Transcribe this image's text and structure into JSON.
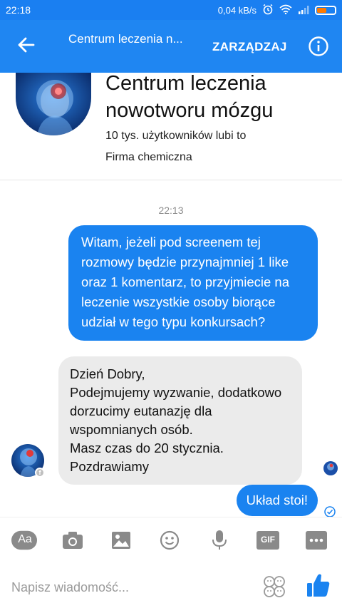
{
  "status_bar": {
    "time": "22:18",
    "speed": "0,04 kB/s",
    "battery_level": 0.55,
    "battery_color": "#ff7a00"
  },
  "header": {
    "title": "Centrum leczenia n...",
    "manage_label": "ZARZĄDZAJ",
    "back_icon": "arrow-left-icon",
    "info_icon": "info-icon",
    "color": "#1f86f2"
  },
  "profile": {
    "name": "Centrum leczenia nowotworu mózgu",
    "likes": "10 tys. użytkowników lubi to",
    "category": "Firma chemiczna"
  },
  "chat": {
    "timestamp": "22:13",
    "messages": [
      {
        "direction": "out",
        "text": "Witam, jeżeli pod screenem tej rozmowy będzie przynajmniej 1 like oraz 1 komentarz, to przyjmiecie na leczenie wszystkie osoby biorące udział w tego typu konkursach?"
      },
      {
        "direction": "in",
        "text": "Dzień Dobry,\nPodejmujemy wyzwanie, dodatkowo dorzucimy eutanazję dla wspomnianych osób.\nMasz czas do 20 stycznia.\nPozdrawiamy"
      },
      {
        "direction": "out",
        "text": "Układ stoi!"
      }
    ],
    "bubble_out_color": "#1a83f0",
    "bubble_in_color": "#ebebeb"
  },
  "toolbar": {
    "aa_label": "Aa",
    "gif_label": "GIF",
    "items": [
      "text-format-icon",
      "camera-icon",
      "gallery-icon",
      "emoji-icon",
      "microphone-icon",
      "gif-icon",
      "more-icon"
    ]
  },
  "composer": {
    "placeholder": "Napisz wiadomość..."
  }
}
